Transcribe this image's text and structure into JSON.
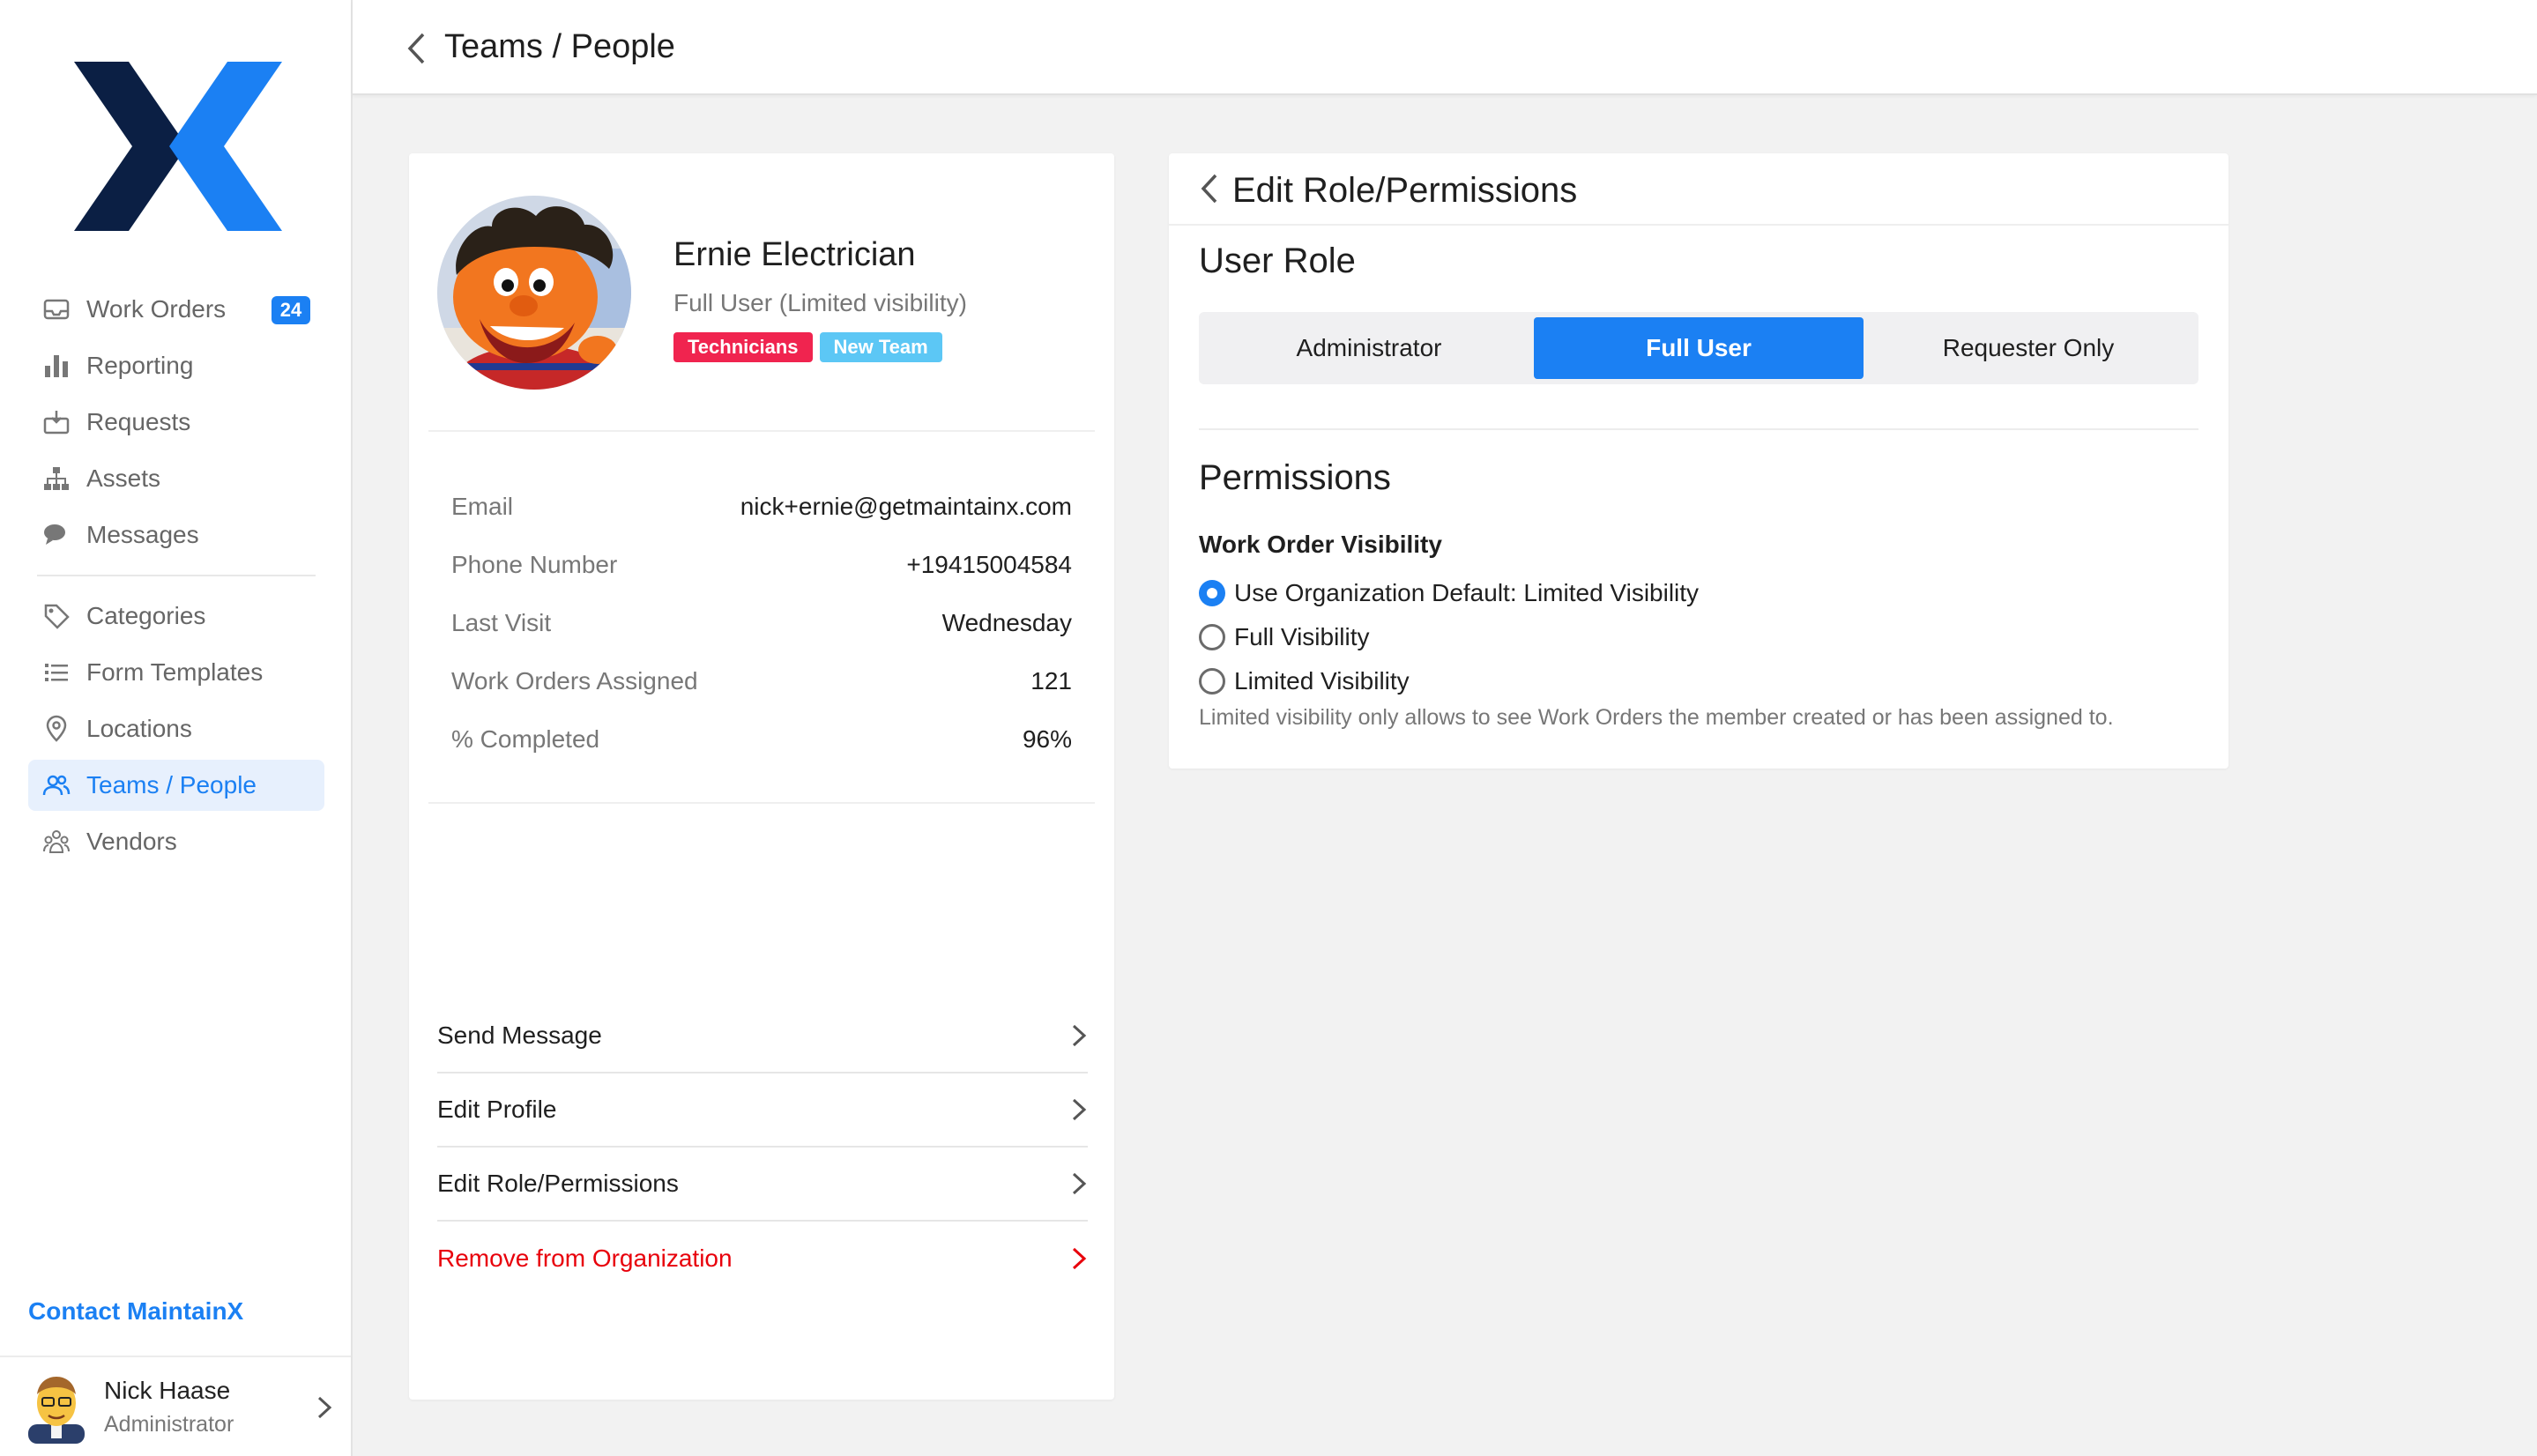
{
  "brand": {
    "accent": "#1b80f3",
    "logo": "maintainx-x-logo"
  },
  "header": {
    "back_icon": "chevron-left-icon",
    "title": "Teams / People"
  },
  "sidebar": {
    "items": [
      {
        "label": "Work Orders",
        "icon": "inbox-tray-icon",
        "badge": "24"
      },
      {
        "label": "Reporting",
        "icon": "bar-chart-icon"
      },
      {
        "label": "Requests",
        "icon": "inbox-download-icon"
      },
      {
        "label": "Assets",
        "icon": "hierarchy-icon"
      },
      {
        "label": "Messages",
        "icon": "chat-bubbles-icon"
      },
      {
        "label": "Categories",
        "icon": "tag-icon"
      },
      {
        "label": "Form Templates",
        "icon": "list-icon"
      },
      {
        "label": "Locations",
        "icon": "map-pin-icon"
      },
      {
        "label": "Teams / People",
        "icon": "people-icon",
        "active": true
      },
      {
        "label": "Vendors",
        "icon": "vendors-icon"
      }
    ],
    "contact": "Contact MaintainX",
    "user": {
      "name": "Nick Haase",
      "role": "Administrator"
    }
  },
  "profile": {
    "name": "Ernie Electrician",
    "role": "Full User (Limited visibility)",
    "tags": [
      {
        "label": "Technicians",
        "color": "#f0244f"
      },
      {
        "label": "New Team",
        "color": "#5cc7f5"
      }
    ],
    "info": [
      {
        "label": "Email",
        "value": "nick+ernie@getmaintainx.com"
      },
      {
        "label": "Phone Number",
        "value": "+19415004584"
      },
      {
        "label": "Last Visit",
        "value": "Wednesday"
      },
      {
        "label": "Work Orders Assigned",
        "value": "121"
      },
      {
        "label": "% Completed",
        "value": "96%"
      }
    ],
    "actions": [
      {
        "label": "Send Message"
      },
      {
        "label": "Edit Profile"
      },
      {
        "label": "Edit Role/Permissions"
      },
      {
        "label": "Remove from Organization",
        "danger": true
      }
    ]
  },
  "permissions_panel": {
    "title": "Edit Role/Permissions",
    "user_role_title": "User Role",
    "roles": [
      "Administrator",
      "Full User",
      "Requester Only"
    ],
    "selected_role": "Full User",
    "permissions_title": "Permissions",
    "visibility_title": "Work Order Visibility",
    "visibility_options": [
      "Use Organization Default: Limited Visibility",
      "Full Visibility",
      "Limited Visibility"
    ],
    "selected_visibility": "Use Organization Default: Limited Visibility",
    "hint": "Limited visibility only allows to see Work Orders the member created or has been assigned to."
  }
}
